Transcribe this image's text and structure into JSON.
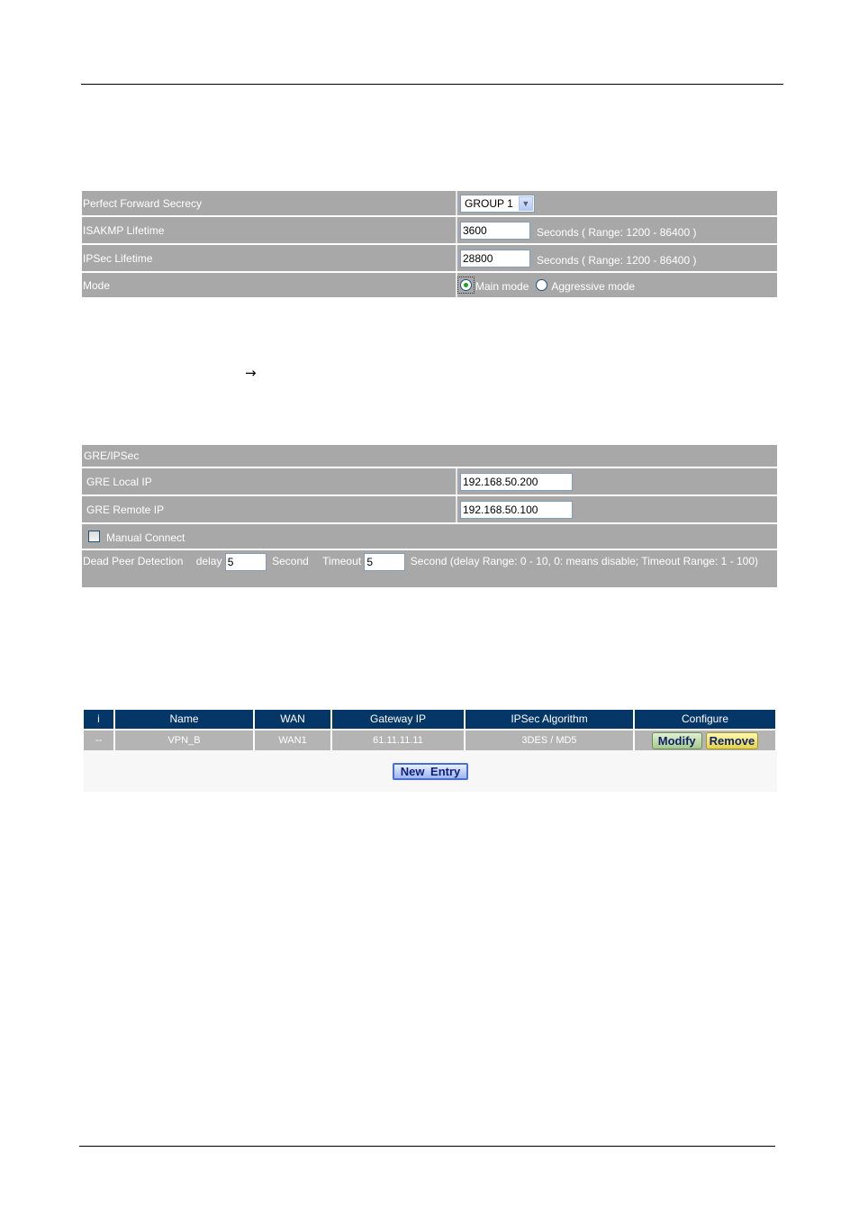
{
  "ike_settings": {
    "rows": [
      {
        "label": "Perfect Forward Secrecy",
        "type": "select",
        "value": "GROUP 1"
      },
      {
        "label": "ISAKMP Lifetime",
        "type": "text",
        "value": "3600",
        "hint": "Seconds  ( Range: 1200 - 86400 )"
      },
      {
        "label": "IPSec Lifetime",
        "type": "text",
        "value": "28800",
        "hint": "Seconds  ( Range: 1200 - 86400 )"
      },
      {
        "label": "Mode",
        "type": "radio",
        "options": [
          "Main mode",
          "Aggressive mode"
        ],
        "selected": "Main mode"
      }
    ]
  },
  "arrow_glyph": "→",
  "gre": {
    "header": "GRE/IPSec",
    "local_ip_label": "GRE Local IP",
    "local_ip_value": "192.168.50.200",
    "remote_ip_label": "GRE Remote IP",
    "remote_ip_value": "192.168.50.100",
    "manual_connect_label": "Manual Connect",
    "manual_connect_checked": false,
    "dpd_label": "Dead Peer Detection",
    "delay_label": "delay",
    "delay_value": "5",
    "second_label": "Second",
    "timeout_label": "Timeout",
    "timeout_value": "5",
    "dpd_hint": "Second (delay Range: 0 - 10, 0: means disable; Timeout Range: 1 - 100)"
  },
  "vpn_list": {
    "columns": [
      "i",
      "Name",
      "WAN",
      "Gateway IP",
      "IPSec Algorithm",
      "Configure"
    ],
    "rows": [
      {
        "index": "--",
        "name": "VPN_B",
        "wan": "WAN1",
        "gateway_ip": "61.11.11.11",
        "algorithm": "3DES / MD5"
      }
    ],
    "modify_label": "Modify",
    "remove_label": "Remove",
    "new_entry_label": "New Entry"
  }
}
